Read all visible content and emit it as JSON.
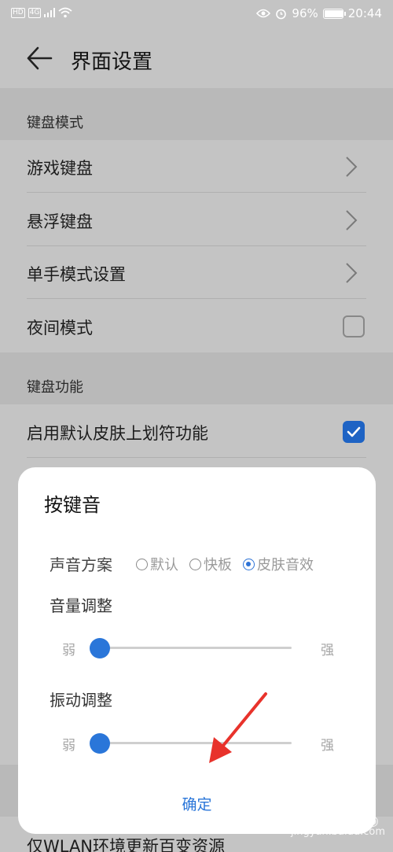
{
  "status_bar": {
    "hd_tag": "HD",
    "net_tag": "4G",
    "battery": "96%",
    "battery_level": 0.96,
    "time": "20:44"
  },
  "header": {
    "title": "界面设置"
  },
  "sections": [
    {
      "title": "键盘模式",
      "rows": [
        {
          "label": "游戏键盘",
          "control": "chevron-right-icon"
        },
        {
          "label": "悬浮键盘",
          "control": "chevron-right-icon"
        },
        {
          "label": "单手模式设置",
          "control": "chevron-right-icon"
        },
        {
          "label": "夜间模式",
          "control": "checkbox",
          "checked": false
        }
      ]
    },
    {
      "title": "键盘功能",
      "rows": [
        {
          "label": "启用默认皮肤上划符功能",
          "control": "checkbox",
          "checked": true
        }
      ]
    }
  ],
  "behind_row": {
    "label": "仅WLAN环境更新百变资源"
  },
  "dialog": {
    "title": "按键音",
    "scheme_label": "声音方案",
    "options": [
      {
        "label": "默认",
        "selected": false
      },
      {
        "label": "快板",
        "selected": false
      },
      {
        "label": "皮肤音效",
        "selected": true
      }
    ],
    "volume": {
      "title": "音量调整",
      "min_label": "弱",
      "max_label": "强",
      "value": 0
    },
    "vibration": {
      "title": "振动调整",
      "min_label": "弱",
      "max_label": "强",
      "value": 0
    },
    "confirm_label": "确定"
  },
  "colors": {
    "accent": "#2a76d9",
    "annotation_arrow": "#e8322b"
  },
  "watermark": {
    "text": "jingyan.baidu.com"
  }
}
